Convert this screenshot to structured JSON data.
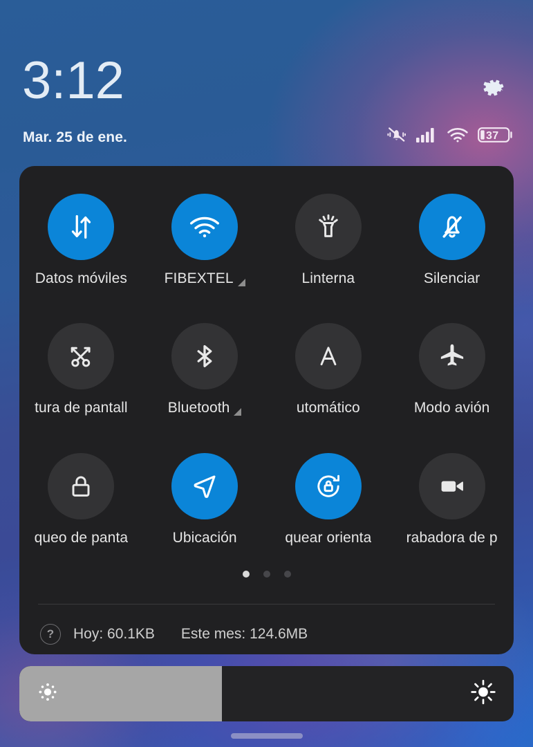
{
  "header": {
    "clock": "3:12",
    "date": "Mar. 25 de ene.",
    "settings_icon": "gear-icon",
    "status_icons": [
      {
        "name": "ringer-silent-vibrate-icon",
        "label": "Silencio / vibración"
      },
      {
        "name": "cellular-signal-icon",
        "label": "Señal móvil"
      },
      {
        "name": "wifi-icon",
        "label": "Wi-Fi"
      },
      {
        "name": "battery-icon",
        "label": "Batería"
      }
    ],
    "battery_level": "37"
  },
  "quick_settings": {
    "tiles": [
      {
        "label": "Datos móviles",
        "icon": "mobile-data-icon",
        "active": true,
        "expandable": false,
        "clip": "none"
      },
      {
        "label": "FIBEXTEL",
        "icon": "wifi-icon",
        "active": true,
        "expandable": true,
        "clip": "none"
      },
      {
        "label": "Linterna",
        "icon": "flashlight-icon",
        "active": false,
        "expandable": false,
        "clip": "none"
      },
      {
        "label": "Silenciar",
        "icon": "bell-off-icon",
        "active": true,
        "expandable": false,
        "clip": "none"
      },
      {
        "label": "tura de pantall",
        "icon": "screenshot-icon",
        "active": false,
        "expandable": false,
        "clip": "both"
      },
      {
        "label": "Bluetooth",
        "icon": "bluetooth-icon",
        "active": false,
        "expandable": true,
        "clip": "none"
      },
      {
        "label": "utomático",
        "icon": "auto-brightness-icon",
        "active": false,
        "expandable": false,
        "clip": "left"
      },
      {
        "label": "Modo avión",
        "icon": "airplane-icon",
        "active": false,
        "expandable": false,
        "clip": "none"
      },
      {
        "label": "queo de panta",
        "icon": "lock-icon",
        "active": false,
        "expandable": false,
        "clip": "both"
      },
      {
        "label": "Ubicación",
        "icon": "location-arrow-icon",
        "active": true,
        "expandable": false,
        "clip": "none"
      },
      {
        "label": "quear orienta",
        "icon": "rotation-lock-icon",
        "active": true,
        "expandable": false,
        "clip": "both"
      },
      {
        "label": "rabadora de p",
        "icon": "screen-recorder-icon",
        "active": false,
        "expandable": false,
        "clip": "right"
      }
    ],
    "pages": {
      "count": 3,
      "active_index": 0
    },
    "footer": {
      "help_icon_label": "?",
      "today_usage": "Hoy: 60.1KB",
      "month_usage": "Este mes: 124.6MB"
    }
  },
  "brightness": {
    "value_percent": 41,
    "low_icon": "brightness-low-icon",
    "high_icon": "brightness-high-icon"
  },
  "navigation": {
    "home_indicator": "home-indicator"
  },
  "colors": {
    "accent_blue": "#0b85d8",
    "panel_background": "#202022",
    "tile_inactive": "#333335",
    "slider_fill": "#a6a6a6",
    "slider_track": "#232325",
    "wallpaper_blue": "#2a5b96"
  }
}
